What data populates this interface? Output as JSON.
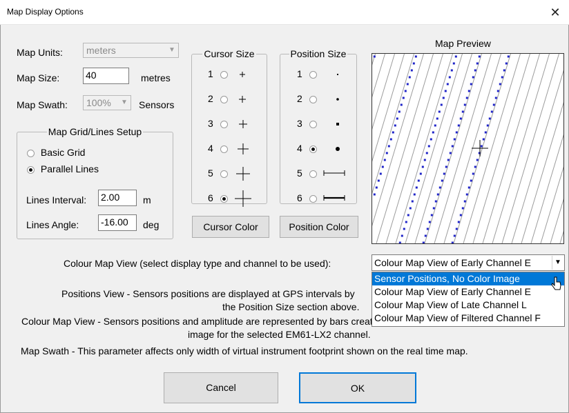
{
  "window": {
    "title": "Map Display Options",
    "close_glyph": "✕"
  },
  "map_units": {
    "label": "Map Units:",
    "value": "meters"
  },
  "map_size": {
    "label": "Map Size:",
    "value": "40",
    "unit": "metres"
  },
  "map_swath": {
    "label": "Map Swath:",
    "value": "100%",
    "unit": "Sensors"
  },
  "grid_setup": {
    "title": "Map Grid/Lines Setup",
    "options": [
      "Basic Grid",
      "Parallel Lines"
    ],
    "selected": "Parallel Lines",
    "interval_label": "Lines Interval:",
    "interval_value": "2.00",
    "interval_unit": "m",
    "angle_label": "Lines Angle:",
    "angle_value": "-16.00",
    "angle_unit": "deg"
  },
  "cursor_size": {
    "title": "Cursor Size",
    "options": [
      "1",
      "2",
      "3",
      "4",
      "5",
      "6"
    ],
    "selected": "6"
  },
  "position_size": {
    "title": "Position Size",
    "options": [
      "1",
      "2",
      "3",
      "4",
      "5",
      "6"
    ],
    "selected": "4"
  },
  "buttons": {
    "cursor_color": "Cursor Color",
    "position_color": "Position Color",
    "cancel": "Cancel",
    "ok": "OK"
  },
  "preview": {
    "title": "Map Preview",
    "dot_color": "#1f24c8",
    "line_color": "#9c9c9c"
  },
  "colour_map": {
    "label": "Colour Map View (select display type and channel to be used):",
    "selected": "Colour Map View of Early Channel E",
    "options": [
      "Sensor Positions, No Color Image",
      "Colour Map View of Early Channel E",
      "Colour Map View of Late Channel L",
      "Colour Map View of Filtered Channel F"
    ],
    "highlighted_index": 0
  },
  "descriptions": {
    "positions_1": "Positions View - Sensors positions are displayed at GPS intervals by",
    "positions_2": "the Position Size section above.",
    "colour_1": "Colour Map View - Sensors positions and amplitude are represented by bars creating continuous colour",
    "colour_2": "image for the selected EM61-LX2 channel.",
    "swath": "Map Swath - This parameter affects only width of virtual instrument footprint shown on the real time map."
  },
  "colors": {
    "accent": "#0078d7",
    "dialog_bg": "#f0f0f0"
  }
}
